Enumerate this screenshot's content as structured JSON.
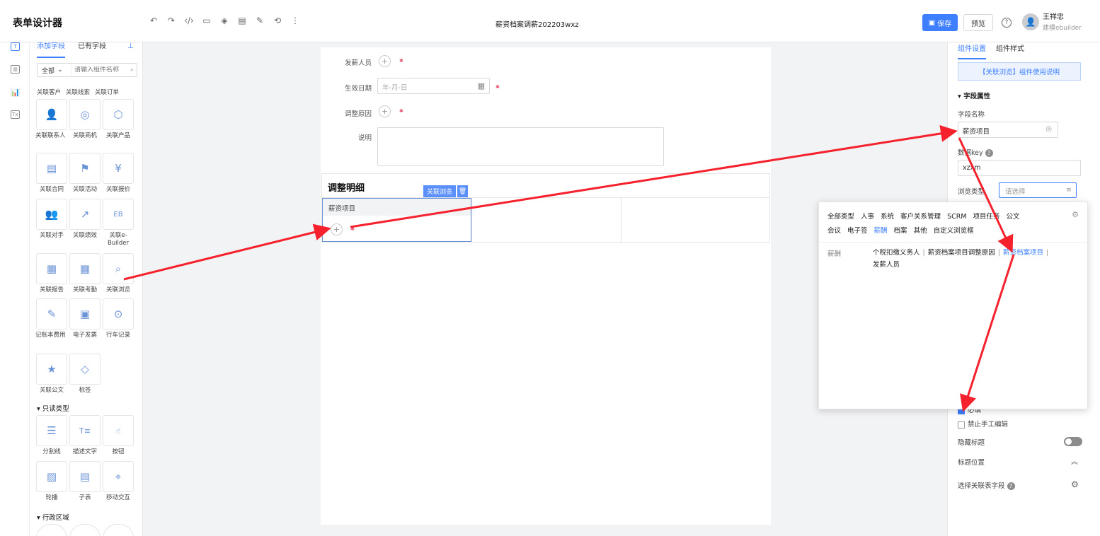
{
  "header": {
    "app_title": "表单设计器",
    "doc_title": "薪资档案调薪202203wxz",
    "save_label": "保存",
    "preview_label": "预览",
    "user_name": "王祥忠",
    "user_sub": "建模ebuilder"
  },
  "left_panel": {
    "tabs": [
      "添加字段",
      "已有字段"
    ],
    "filter_value": "全部",
    "search_placeholder": "请输入组件名称",
    "row0": [
      "关联客户",
      "关联线索",
      "关联订单"
    ],
    "items": [
      [
        "关联联系人",
        "关联商机",
        "关联产品"
      ],
      [
        "关联合同",
        "关联活动",
        "关联报价"
      ],
      [
        "关联对手",
        "关联绩效",
        "关联e-Builder"
      ],
      [
        "关联报告",
        "关联考勤",
        "关联浏览"
      ],
      [
        "记账本费用",
        "电子发票",
        "行车记录"
      ],
      [
        "关联公文",
        "标签"
      ]
    ],
    "section_readonly": "只读类型",
    "readonly_items": [
      [
        "分割线",
        "描述文字",
        "按钮"
      ],
      [
        "轮播",
        "子表",
        "移动交互"
      ]
    ],
    "section_admin": "行政区域"
  },
  "canvas": {
    "field_payer": "发薪人员",
    "field_date": "生效日期",
    "date_placeholder": "年-月-日",
    "field_reason": "调整原因",
    "field_desc": "说明",
    "subtable_title": "调整明细",
    "subtable_col": "薪资项目",
    "tag_label": "关联浏览"
  },
  "right_panel": {
    "tabs": [
      "组件设置",
      "组件样式"
    ],
    "usage_link": "【关联浏览】组件使用说明",
    "section_title": "字段属性",
    "field_name_label": "字段名称",
    "field_name_value": "薪资项目",
    "data_key_label": "数据key",
    "data_key_value": "xzxm",
    "browse_type_label": "浏览类型",
    "browse_type_placeholder": "请选择",
    "required_label": "必填",
    "forbid_manual_label": "禁止手工编辑",
    "hide_title_label": "隐藏标题",
    "title_position_label": "标题位置",
    "select_related_label": "选择关联表字段"
  },
  "dropdown": {
    "categories": [
      "全部类型",
      "人事",
      "系统",
      "客户关系管理",
      "SCRM",
      "项目任务",
      "公文",
      "会议",
      "电子签",
      "薪酬",
      "档案",
      "其他",
      "自定义浏览框"
    ],
    "active_category": "薪酬",
    "group_label": "薪酬",
    "options": [
      "个税扣缴义务人",
      "薪资档案项目调整原因",
      "薪资档案项目",
      "发薪人员"
    ],
    "highlighted_option": "薪资档案项目"
  }
}
